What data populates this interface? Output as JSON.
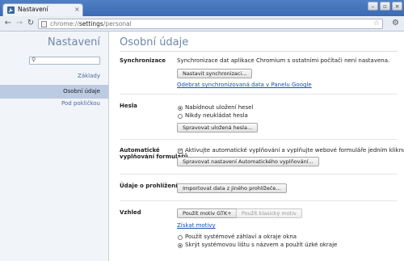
{
  "window": {
    "tab_title": "Nastavení",
    "tab_close": "×",
    "controls": [
      "–",
      "▫",
      "×"
    ]
  },
  "toolbar": {
    "url_prefix": "chrome://",
    "url_main": "settings",
    "url_suffix": "/personal"
  },
  "sidebar": {
    "title": "Nastavení",
    "search_placeholder": "",
    "items": [
      {
        "label": "Základy"
      },
      {
        "label": "Osobní údaje"
      },
      {
        "label": "Pod pokličkou"
      }
    ]
  },
  "main": {
    "title": "Osobní údaje",
    "sync": {
      "label": "Synchronizace",
      "status": "Synchronizace dat aplikace Chromium s ostatními počítači není nastavena.",
      "button": "Nastavit synchronizaci...",
      "link": "Odebrat synchronizovaná data v Panelu Google"
    },
    "passwords": {
      "label": "Hesla",
      "option_offer": "Nabídnout uložení hesel",
      "option_never": "Nikdy neukládat hesla",
      "button": "Spravovat uložená hesla..."
    },
    "autofill": {
      "label_line1": "Automatické",
      "label_line2": "vyplňování formulářů",
      "checkbox": "Aktivujte automatické vyplňování a vyplňujte webové formuláře jedním kliknutím",
      "button": "Spravovat nastavení Automatického vyplňování..."
    },
    "browsing": {
      "label": "Údaje o prohlížení",
      "button": "Importovat data z jiného prohlížeče..."
    },
    "appearance": {
      "label": "Vzhled",
      "button_gtk": "Použít motiv GTK+",
      "button_classic": "Použít klasický motiv",
      "link": "Získat motivy",
      "option_system": "Použít systémové záhlaví a okraje okna",
      "option_hide": "Skrýt systémovou lištu s názvem a použít úzké okraje"
    }
  }
}
